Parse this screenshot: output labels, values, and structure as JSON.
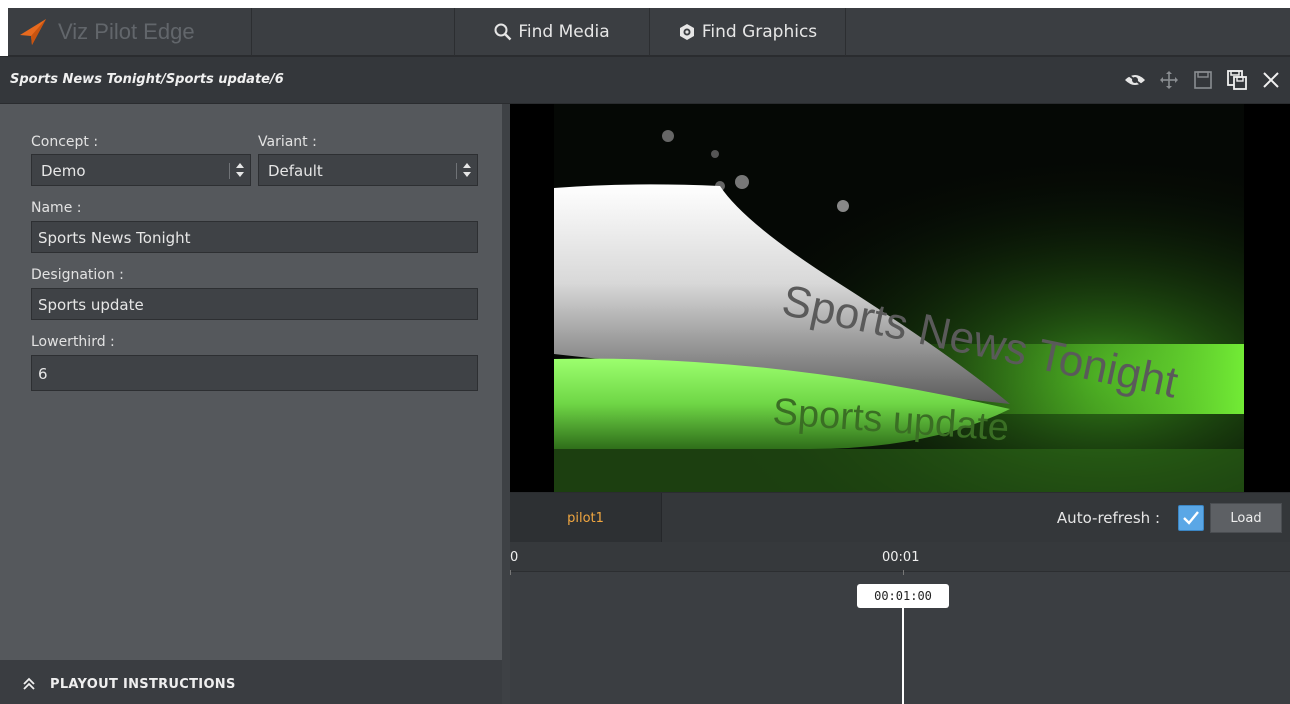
{
  "app": {
    "name": "Viz Pilot Edge"
  },
  "topbar": {
    "find_media": "Find Media",
    "find_graphics": "Find Graphics"
  },
  "pathbar": {
    "path": "Sports News Tonight/Sports update/6",
    "tools": [
      "preview-toggle-icon",
      "move-icon",
      "save-icon",
      "save-as-icon",
      "close-icon"
    ]
  },
  "form": {
    "concept_label": "Concept :",
    "concept_value": "Demo",
    "variant_label": "Variant :",
    "variant_value": "Default",
    "name_label": "Name :",
    "name_value": "Sports News Tonight",
    "designation_label": "Designation :",
    "designation_value": "Sports update",
    "lowerthird_label": "Lowerthird :",
    "lowerthird_value": "6"
  },
  "playout": {
    "label": "PLAYOUT INSTRUCTIONS"
  },
  "preview": {
    "headline": "Sports News Tonight",
    "subline": "Sports update"
  },
  "player": {
    "tab": "pilot1",
    "auto_refresh_label": "Auto-refresh :",
    "auto_refresh_checked": true,
    "load_label": "Load"
  },
  "timeline": {
    "tick_start": "0",
    "tick_1": "00:01",
    "playhead": "00:01:00"
  },
  "colors": {
    "accent_orange": "#f0a640",
    "checkbox_blue": "#5aa7e6",
    "glow_green": "#7cff3a"
  }
}
